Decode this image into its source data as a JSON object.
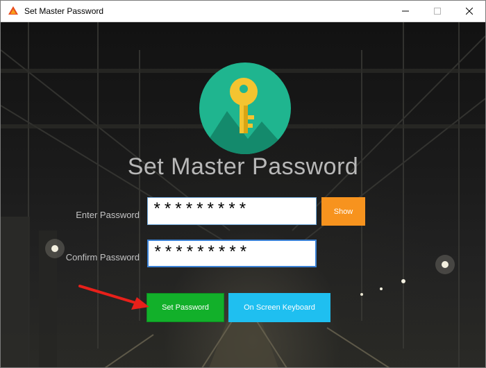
{
  "window": {
    "title": "Set Master Password",
    "controls": [
      "minimize",
      "maximize",
      "close"
    ]
  },
  "heading": "Set Master Password",
  "form": {
    "enter_label": "Enter Password",
    "enter_value": "*********",
    "confirm_label": "Confirm Password",
    "confirm_value": "*********",
    "show_label": "Show"
  },
  "actions": {
    "set_password_label": "Set Password",
    "keyboard_label": "On Screen Keyboard"
  },
  "colors": {
    "logo_circle": "#1fb58f",
    "key": "#f4c430",
    "show_button": "#f7931e",
    "set_button": "#12b02a",
    "keyboard_button": "#1fbff0",
    "annotation_arrow": "#e8201a"
  },
  "icons": [
    "app-icon",
    "key-icon",
    "minimize-icon",
    "maximize-icon",
    "close-icon",
    "arrow-annotation"
  ]
}
